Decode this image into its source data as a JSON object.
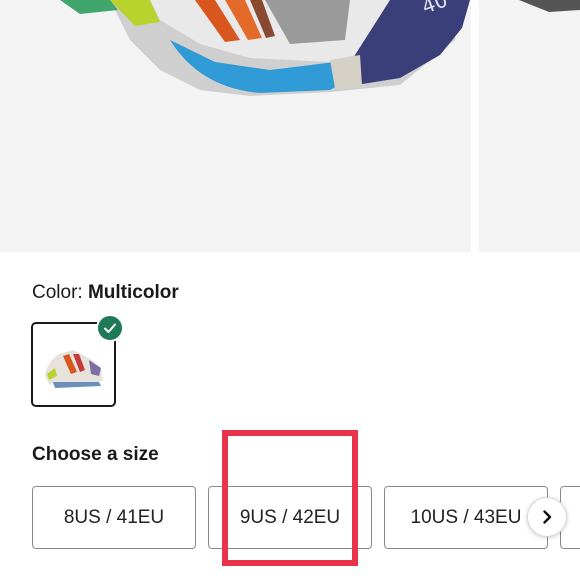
{
  "gallery": {
    "images": [
      {
        "icon": "sneaker-photo"
      },
      {
        "icon": "sneaker-photo"
      }
    ]
  },
  "color": {
    "label": "Color: ",
    "value": "Multicolor",
    "swatch": {
      "icon": "sneaker-thumbnail",
      "selected": true,
      "check_color": "#1f7a5a"
    }
  },
  "size": {
    "heading": "Choose a size",
    "options": [
      {
        "label": "8US / 41EU"
      },
      {
        "label": "9US / 42EU"
      },
      {
        "label": "10US / 43EU"
      },
      {
        "label": ""
      }
    ],
    "next_icon": "chevron-right-icon"
  },
  "annotation": {
    "color": "#e8344a"
  }
}
